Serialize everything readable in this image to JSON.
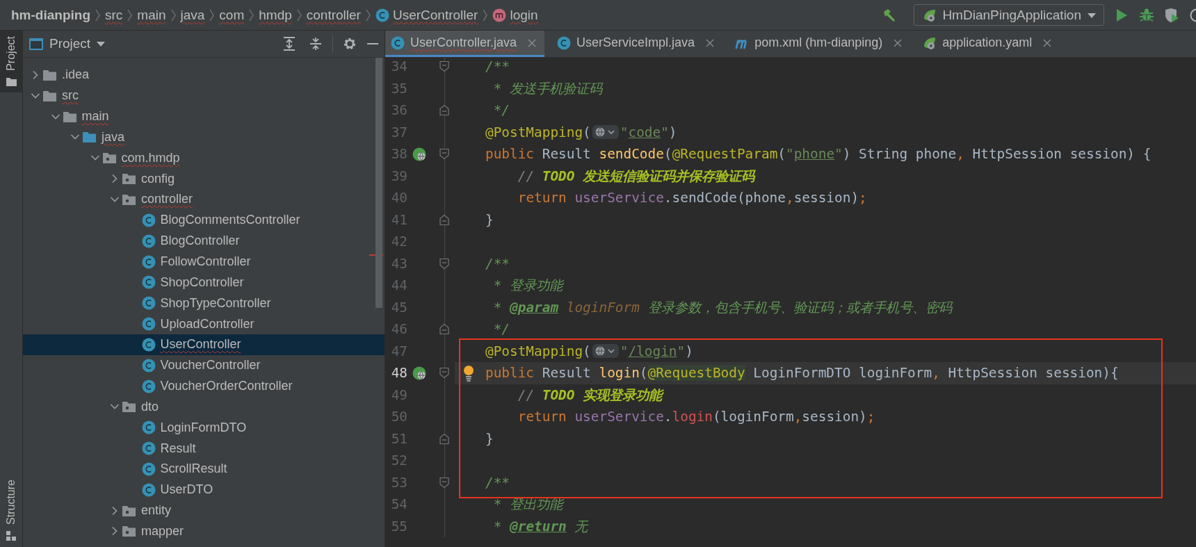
{
  "breadcrumbs": [
    {
      "label": "hm-dianping",
      "kind": "project",
      "misspelled": false
    },
    {
      "label": "src",
      "kind": "dir",
      "misspelled": true
    },
    {
      "label": "main",
      "kind": "dir",
      "misspelled": true
    },
    {
      "label": "java",
      "kind": "dir",
      "misspelled": true
    },
    {
      "label": "com",
      "kind": "dir",
      "misspelled": true
    },
    {
      "label": "hmdp",
      "kind": "dir",
      "misspelled": true
    },
    {
      "label": "controller",
      "kind": "dir",
      "misspelled": true
    },
    {
      "label": "UserController",
      "kind": "class",
      "misspelled": true
    },
    {
      "label": "login",
      "kind": "method",
      "misspelled": true
    }
  ],
  "toolbar": {
    "run_configuration": "HmDianPingApplication"
  },
  "tool_strip": [
    {
      "label": "Project",
      "kind": "project",
      "selected": true
    },
    {
      "label": "Structure",
      "kind": "structure",
      "selected": false
    }
  ],
  "project_panel": {
    "title": "Project",
    "tree": [
      {
        "label": ".idea",
        "kind": "folder",
        "expanded": false,
        "selected": false,
        "misspelled": false
      },
      {
        "label": "src",
        "kind": "folder",
        "expanded": true,
        "selected": false,
        "misspelled": true,
        "children": [
          {
            "label": "main",
            "kind": "folder",
            "expanded": true,
            "selected": false,
            "misspelled": true,
            "children": [
              {
                "label": "java",
                "kind": "sources",
                "expanded": true,
                "selected": false,
                "misspelled": true,
                "children": [
                  {
                    "label": "com.hmdp",
                    "kind": "package",
                    "expanded": true,
                    "selected": false,
                    "misspelled": true,
                    "children": [
                      {
                        "label": "config",
                        "kind": "package",
                        "expanded": false,
                        "selected": false,
                        "misspelled": false
                      },
                      {
                        "label": "controller",
                        "kind": "package",
                        "expanded": true,
                        "selected": false,
                        "misspelled": true,
                        "children": [
                          {
                            "label": "BlogCommentsController",
                            "kind": "class",
                            "selected": false,
                            "misspelled": false
                          },
                          {
                            "label": "BlogController",
                            "kind": "class",
                            "selected": false,
                            "misspelled": false
                          },
                          {
                            "label": "FollowController",
                            "kind": "class",
                            "selected": false,
                            "misspelled": false
                          },
                          {
                            "label": "ShopController",
                            "kind": "class",
                            "selected": false,
                            "misspelled": false
                          },
                          {
                            "label": "ShopTypeController",
                            "kind": "class",
                            "selected": false,
                            "misspelled": false
                          },
                          {
                            "label": "UploadController",
                            "kind": "class",
                            "selected": false,
                            "misspelled": false
                          },
                          {
                            "label": "UserController",
                            "kind": "class",
                            "selected": true,
                            "misspelled": true
                          },
                          {
                            "label": "VoucherController",
                            "kind": "class",
                            "selected": false,
                            "misspelled": false
                          },
                          {
                            "label": "VoucherOrderController",
                            "kind": "class",
                            "selected": false,
                            "misspelled": false
                          }
                        ]
                      },
                      {
                        "label": "dto",
                        "kind": "package",
                        "expanded": true,
                        "selected": false,
                        "misspelled": false,
                        "children": [
                          {
                            "label": "LoginFormDTO",
                            "kind": "class",
                            "selected": false,
                            "misspelled": false
                          },
                          {
                            "label": "Result",
                            "kind": "class",
                            "selected": false,
                            "misspelled": false
                          },
                          {
                            "label": "ScrollResult",
                            "kind": "class",
                            "selected": false,
                            "misspelled": false
                          },
                          {
                            "label": "UserDTO",
                            "kind": "class",
                            "selected": false,
                            "misspelled": false
                          }
                        ]
                      },
                      {
                        "label": "entity",
                        "kind": "package",
                        "expanded": false,
                        "selected": false,
                        "misspelled": false
                      },
                      {
                        "label": "mapper",
                        "kind": "package",
                        "expanded": false,
                        "selected": false,
                        "misspelled": false
                      }
                    ]
                  }
                ]
              }
            ]
          }
        ]
      }
    ]
  },
  "editor": {
    "tabs": [
      {
        "label": "UserController.java",
        "kind": "class",
        "selected": true,
        "misspelled": true
      },
      {
        "label": "UserServiceImpl.java",
        "kind": "class",
        "selected": false,
        "misspelled": false
      },
      {
        "label": "pom.xml (hm-dianping)",
        "kind": "maven",
        "selected": false,
        "misspelled": false
      },
      {
        "label": "application.yaml",
        "kind": "spring",
        "selected": false,
        "misspelled": false
      }
    ],
    "lines": [
      {
        "number": "34",
        "fold_start": true,
        "fold_end": false,
        "endpoint": false,
        "current": false,
        "boxed": false,
        "intention": false,
        "tokens": [
          {
            "kind": "doc",
            "text": "/**"
          }
        ]
      },
      {
        "number": "35",
        "fold_start": false,
        "fold_end": false,
        "endpoint": false,
        "current": false,
        "boxed": false,
        "intention": false,
        "tokens": [
          {
            "kind": "doc",
            "text": " * 发送手机验证码"
          }
        ]
      },
      {
        "number": "36",
        "fold_start": false,
        "fold_end": true,
        "endpoint": false,
        "current": false,
        "boxed": false,
        "intention": false,
        "tokens": [
          {
            "kind": "doc",
            "text": " */"
          }
        ]
      },
      {
        "number": "37",
        "fold_start": false,
        "fold_end": false,
        "endpoint": false,
        "current": false,
        "boxed": false,
        "intention": false,
        "tokens": [
          {
            "kind": "anno",
            "text": "@PostMapping"
          },
          {
            "kind": "plain",
            "text": "("
          },
          {
            "kind": "inlay"
          },
          {
            "kind": "string",
            "text": "\""
          },
          {
            "kind": "link",
            "text": "code"
          },
          {
            "kind": "string",
            "text": "\""
          },
          {
            "kind": "plain",
            "text": ")"
          }
        ]
      },
      {
        "number": "38",
        "fold_start": true,
        "fold_end": false,
        "endpoint": true,
        "current": false,
        "boxed": false,
        "intention": false,
        "tokens": [
          {
            "kind": "kw",
            "text": "public"
          },
          {
            "kind": "plain",
            "text": " Result "
          },
          {
            "kind": "method",
            "text": "sendCode"
          },
          {
            "kind": "plain",
            "text": "("
          },
          {
            "kind": "anno",
            "text": "@RequestParam"
          },
          {
            "kind": "plain",
            "text": "("
          },
          {
            "kind": "string",
            "text": "\""
          },
          {
            "kind": "link",
            "text": "phone"
          },
          {
            "kind": "string",
            "text": "\""
          },
          {
            "kind": "plain",
            "text": ") String phone"
          },
          {
            "kind": "kw",
            "text": ","
          },
          {
            "kind": "plain",
            "text": " HttpSession session) {"
          }
        ]
      },
      {
        "number": "39",
        "fold_start": false,
        "fold_end": false,
        "endpoint": false,
        "current": false,
        "boxed": false,
        "intention": false,
        "tokens": [
          {
            "kind": "comment",
            "text": "    // "
          },
          {
            "kind": "todo",
            "text": "TODO 发送短信验证码并保存验证码"
          }
        ]
      },
      {
        "number": "40",
        "fold_start": false,
        "fold_end": false,
        "endpoint": false,
        "current": false,
        "boxed": false,
        "intention": false,
        "tokens": [
          {
            "kind": "kw",
            "text": "    return "
          },
          {
            "kind": "field",
            "text": "userService"
          },
          {
            "kind": "plain",
            "text": ".sendCode(phone"
          },
          {
            "kind": "kw",
            "text": ","
          },
          {
            "kind": "plain",
            "text": "session)"
          },
          {
            "kind": "kw",
            "text": ";"
          }
        ]
      },
      {
        "number": "41",
        "fold_start": false,
        "fold_end": true,
        "endpoint": false,
        "current": false,
        "boxed": false,
        "intention": false,
        "tokens": [
          {
            "kind": "plain",
            "text": "}"
          }
        ]
      },
      {
        "number": "42",
        "fold_start": false,
        "fold_end": false,
        "endpoint": false,
        "current": false,
        "boxed": false,
        "intention": false
      },
      {
        "number": "43",
        "fold_start": true,
        "fold_end": false,
        "endpoint": false,
        "current": false,
        "boxed": false,
        "intention": false,
        "tokens": [
          {
            "kind": "doc",
            "text": "/**"
          }
        ]
      },
      {
        "number": "44",
        "fold_start": false,
        "fold_end": false,
        "endpoint": false,
        "current": false,
        "boxed": false,
        "intention": false,
        "tokens": [
          {
            "kind": "doc",
            "text": " * 登录功能"
          }
        ]
      },
      {
        "number": "45",
        "fold_start": false,
        "fold_end": false,
        "endpoint": false,
        "current": false,
        "boxed": false,
        "intention": false,
        "tokens": [
          {
            "kind": "doc",
            "text": " * "
          },
          {
            "kind": "doctag",
            "text": "@param"
          },
          {
            "kind": "docparam",
            "text": " loginForm"
          },
          {
            "kind": "doc",
            "text": " 登录参数，包含手机号、验证码；或者手机号、密码"
          }
        ]
      },
      {
        "number": "46",
        "fold_start": false,
        "fold_end": true,
        "endpoint": false,
        "current": false,
        "boxed": false,
        "intention": false,
        "tokens": [
          {
            "kind": "doc",
            "text": " */"
          }
        ]
      },
      {
        "number": "47",
        "fold_start": false,
        "fold_end": false,
        "endpoint": false,
        "current": false,
        "boxed": true,
        "intention": false,
        "tokens": [
          {
            "kind": "anno",
            "text": "@PostMapping"
          },
          {
            "kind": "plain",
            "text": "("
          },
          {
            "kind": "inlay"
          },
          {
            "kind": "string",
            "text": "\""
          },
          {
            "kind": "link",
            "text": "/login"
          },
          {
            "kind": "string",
            "text": "\""
          },
          {
            "kind": "plain",
            "text": ")"
          }
        ]
      },
      {
        "number": "48",
        "fold_start": true,
        "fold_end": false,
        "endpoint": true,
        "current": true,
        "boxed": true,
        "intention": true,
        "tokens": [
          {
            "kind": "kw",
            "text": "public"
          },
          {
            "kind": "plain",
            "text": " Result "
          },
          {
            "kind": "method",
            "text": "login"
          },
          {
            "kind": "plain",
            "text": "("
          },
          {
            "kind": "anno-hl",
            "text": "@RequestBody"
          },
          {
            "kind": "plain",
            "text": " LoginFormDTO loginForm"
          },
          {
            "kind": "kw",
            "text": ","
          },
          {
            "kind": "plain",
            "text": " HttpSession session){"
          }
        ]
      },
      {
        "number": "49",
        "fold_start": false,
        "fold_end": false,
        "endpoint": false,
        "current": false,
        "boxed": true,
        "intention": false,
        "tokens": [
          {
            "kind": "comment",
            "text": "    // "
          },
          {
            "kind": "todo",
            "text": "TODO 实现登录功能"
          }
        ]
      },
      {
        "number": "50",
        "fold_start": false,
        "fold_end": false,
        "endpoint": false,
        "current": false,
        "boxed": true,
        "intention": false,
        "tokens": [
          {
            "kind": "kw",
            "text": "    return "
          },
          {
            "kind": "field",
            "text": "userService"
          },
          {
            "kind": "plain",
            "text": "."
          },
          {
            "kind": "error",
            "text": "login"
          },
          {
            "kind": "plain",
            "text": "(loginForm"
          },
          {
            "kind": "kw",
            "text": ","
          },
          {
            "kind": "plain",
            "text": "session)"
          },
          {
            "kind": "kw",
            "text": ";"
          }
        ]
      },
      {
        "number": "51",
        "fold_start": false,
        "fold_end": true,
        "endpoint": false,
        "current": false,
        "boxed": true,
        "intention": false,
        "tokens": [
          {
            "kind": "plain",
            "text": "}"
          }
        ]
      },
      {
        "number": "52",
        "fold_start": false,
        "fold_end": false,
        "endpoint": false,
        "current": false,
        "boxed": true,
        "intention": false
      },
      {
        "number": "53",
        "fold_start": true,
        "fold_end": false,
        "endpoint": false,
        "current": false,
        "boxed": true,
        "intention": false,
        "tokens": [
          {
            "kind": "doc",
            "text": "/**"
          }
        ]
      },
      {
        "number": "54",
        "fold_start": false,
        "fold_end": false,
        "endpoint": false,
        "current": false,
        "boxed": false,
        "intention": false,
        "tokens": [
          {
            "kind": "doc",
            "text": " * 登出功能"
          }
        ]
      },
      {
        "number": "55",
        "fold_start": false,
        "fold_end": false,
        "endpoint": false,
        "current": false,
        "boxed": false,
        "intention": false,
        "tokens": [
          {
            "kind": "doc",
            "text": " * "
          },
          {
            "kind": "doctag",
            "text": "@return"
          },
          {
            "kind": "doc",
            "text": " 无"
          }
        ]
      }
    ]
  }
}
